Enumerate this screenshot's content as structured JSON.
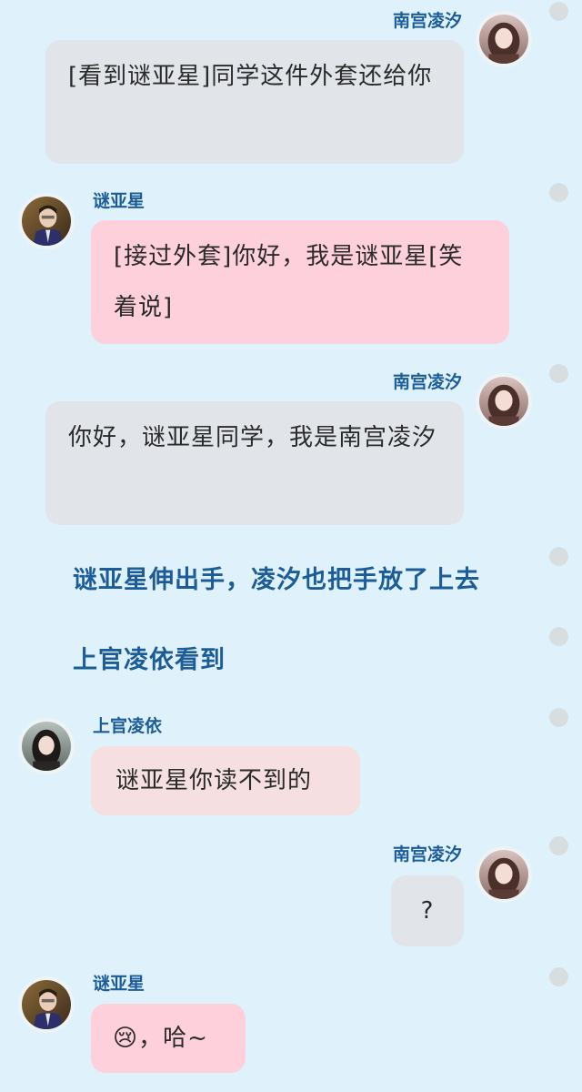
{
  "characters": {
    "nangong": {
      "name": "南宫凌汐"
    },
    "mi": {
      "name": "谜亚星"
    },
    "shangguan": {
      "name": "上官凌依"
    }
  },
  "messages": [
    {
      "speaker": "南宫凌汐",
      "side": "right",
      "text": "[看到谜亚星]同学这件外套还给你"
    },
    {
      "speaker": "谜亚星",
      "side": "left",
      "text": "[接过外套]你好，我是谜亚星[笑着说]"
    },
    {
      "speaker": "南宫凌汐",
      "side": "right",
      "text": "你好，谜亚星同学，我是南宫凌汐"
    },
    {
      "speaker": "",
      "side": "narration",
      "text": "谜亚星伸出手，凌汐也把手放了上去"
    },
    {
      "speaker": "",
      "side": "narration",
      "text": "上官凌依看到"
    },
    {
      "speaker": "上官凌依",
      "side": "left",
      "text": "谜亚星你读不到的"
    },
    {
      "speaker": "南宫凌汐",
      "side": "right",
      "text": "?"
    },
    {
      "speaker": "谜亚星",
      "side": "left",
      "text": "😢，哈~"
    }
  ],
  "colors": {
    "background": "#dff2fc",
    "name_text": "#1c5d99",
    "bubble_gray": "#e1e5ea",
    "bubble_pink": "#fdd0dc",
    "bubble_beige": "#f5dfe0",
    "select_dot": "#d8dde0"
  },
  "icons": {
    "select_dot": "selection-circle",
    "avatar": "profile-photo"
  }
}
